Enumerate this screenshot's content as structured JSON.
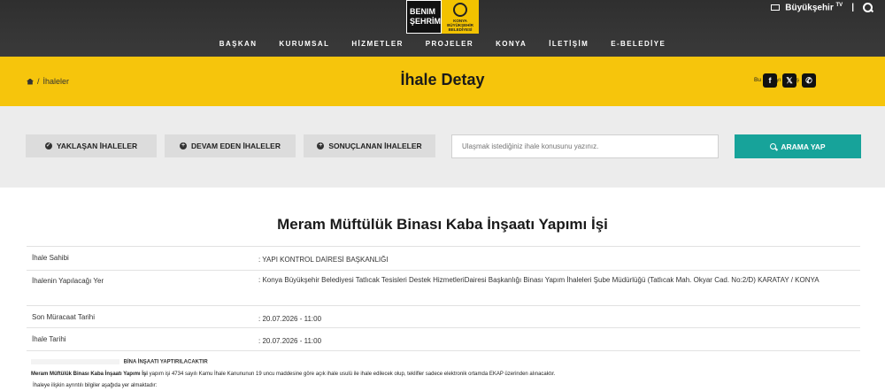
{
  "logo": {
    "benim_line1": "BENIM",
    "benim_line2": "ŞEHRİM",
    "konya_line1": "KONYA",
    "konya_line2": "BÜYÜKŞEHİR",
    "konya_line3": "BELEDİYESİ"
  },
  "top_right": {
    "buyuksehir_label": "Büyükşehir",
    "tv_label": "TV",
    "separator": "|"
  },
  "nav": [
    "BAŞKAN",
    "KURUMSAL",
    "HİZMETLER",
    "PROJELER",
    "KONYA",
    "İLETİŞİM",
    "E-BELEDİYE"
  ],
  "breadcrumb": {
    "separator": "/",
    "current": "İhaleler"
  },
  "page_title": "İhale Detay",
  "share": {
    "label": "Bu sayfayı paylaş",
    "facebook": "f",
    "x": "𝕏",
    "whatsapp": "✆"
  },
  "filters": {
    "upcoming": "YAKLAŞAN İHALELER",
    "ongoing": "DEVAM EDEN İHALELER",
    "concluded": "SONUÇLANAN İHALELER",
    "search_placeholder": "Ulaşmak istediğiniz ihale konusunu yazınız.",
    "search_button": "ARAMA YAP"
  },
  "detail": {
    "title": "Meram Müftülük Binası Kaba İnşaatı Yapımı İşi",
    "rows": [
      {
        "label": "İhale Sahibi",
        "value": ": YAPI KONTROL DAİRESİ BAŞKANLIĞI"
      },
      {
        "label": "İhalenin Yapılacağı Yer",
        "value": ": Konya Büyükşehir Belediyesi Tatlıcak Tesisleri Destek HizmetleriDairesi Başkanlığı Binası Yapım İhaleleri Şube Müdürlüğü (Tatlıcak Mah. Okyar Cad. No:2/D) KARATAY / KONYA"
      },
      {
        "label": "Son Müracaat Tarihi",
        "value": ": 20.07.2026 - 11:00"
      },
      {
        "label": "İhale Tarihi",
        "value": ": 20.07.2026 - 11:00"
      }
    ],
    "desc_heading": "BİNA İNŞAATI YAPTIRILACAKTIR",
    "desc_bold": "Meram Müftülük Binası Kaba İnşaatı Yapımı İşi",
    "desc_line1_rest": " yapım işi 4734 sayılı Kamu İhale Kanununun 19 uncu maddesine göre açık ihale usulü ile ihale edilecek olup, teklifler sadece elektronik ortamda EKAP üzerinden alınacaktır.",
    "desc_line2": "İhaleye ilişkin ayrıntılı bilgiler aşağıda yer almaktadır:"
  }
}
